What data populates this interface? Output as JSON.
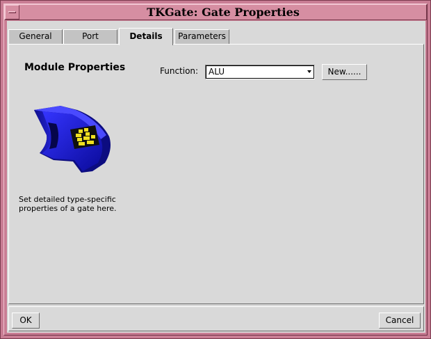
{
  "window": {
    "title": "TKGate: Gate Properties"
  },
  "tabs": [
    {
      "label": "General",
      "active": false
    },
    {
      "label": "Port",
      "active": false
    },
    {
      "label": "Details",
      "active": true
    },
    {
      "label": "Parameters",
      "active": false
    }
  ],
  "details": {
    "section_title": "Module Properties",
    "description": "Set detailed type-specific properties of a gate here.",
    "gate_image_icon": "alu-gate-icon",
    "function_label": "Function:",
    "function_value": "ALU",
    "new_button_label": "New......"
  },
  "footer": {
    "ok_label": "OK",
    "cancel_label": "Cancel"
  },
  "colors": {
    "frame": "#c97d94",
    "titlebar": "#d68ea2",
    "background": "#d9d9d9",
    "gate_blue": "#1a1ad6",
    "gate_yellow": "#f0e020"
  }
}
